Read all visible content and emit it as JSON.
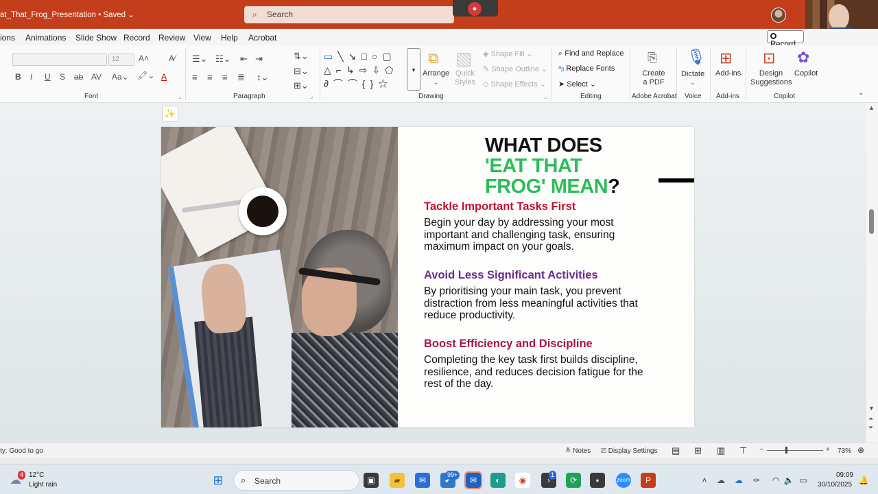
{
  "titlebar": {
    "doc_title": "at_That_Frog_Presentation • Saved ⌄",
    "search_placeholder": "Search",
    "search_icon": "search-icon"
  },
  "menu": {
    "items": [
      "ions",
      "Animations",
      "Slide Show",
      "Record",
      "Review",
      "View",
      "Help",
      "Acrobat"
    ],
    "record_button": "Record"
  },
  "ribbon": {
    "font_group": "Font",
    "font_size": "12",
    "paragraph_group": "Paragraph",
    "drawing_group": "Drawing",
    "arrange": "Arrange",
    "quick_styles": "Quick Styles",
    "shape_fill": "Shape Fill",
    "shape_outline": "Shape Outline",
    "shape_effects": "Shape Effects",
    "find_replace": "Find and Replace",
    "replace_fonts": "Replace Fonts",
    "select": "Select",
    "editing_group": "Editing",
    "create_pdf_1": "Create",
    "create_pdf_2": "a PDF",
    "adobe_group": "Adobe Acrobat",
    "dictate": "Dictate",
    "voice_group": "Voice",
    "addins": "Add-ins",
    "addins_group": "Add-ins",
    "design_1": "Design",
    "design_2": "Suggestions",
    "copilot": "Copilot",
    "copilot_group": "Copilot"
  },
  "slide": {
    "title_line1": "WHAT DOES",
    "title_line2": "'EAT THAT",
    "title_line3a": "FROG' MEAN",
    "title_line3b": "?",
    "sections": [
      {
        "heading": "Tackle Important Tasks First",
        "heading_color": "#c0112f",
        "body": "Begin your day by addressing your most important and challenging task, ensuring maximum impact on your goals."
      },
      {
        "heading": "Avoid Less Significant Activities",
        "heading_color": "#6a2a8f",
        "body": "By prioritising your main task, you prevent distraction from less meaningful activities that reduce productivity."
      },
      {
        "heading": "Boost Efficiency and Discipline",
        "heading_color": "#a7124f",
        "body": "Completing the key task first builds discipline, resilience, and reduces decision fatigue for the rest of the day."
      }
    ]
  },
  "statusbar": {
    "accessibility": "ty: Good to go",
    "notes": "Notes",
    "display_settings": "Display Settings",
    "zoom": "73%"
  },
  "taskbar": {
    "weather_temp": "12°C",
    "weather_desc": "Light rain",
    "weather_badge": "4",
    "search": "Search",
    "mail_badge": "99+",
    "chat_badge": "1",
    "time": "09:09",
    "date": "30/10/2025"
  }
}
